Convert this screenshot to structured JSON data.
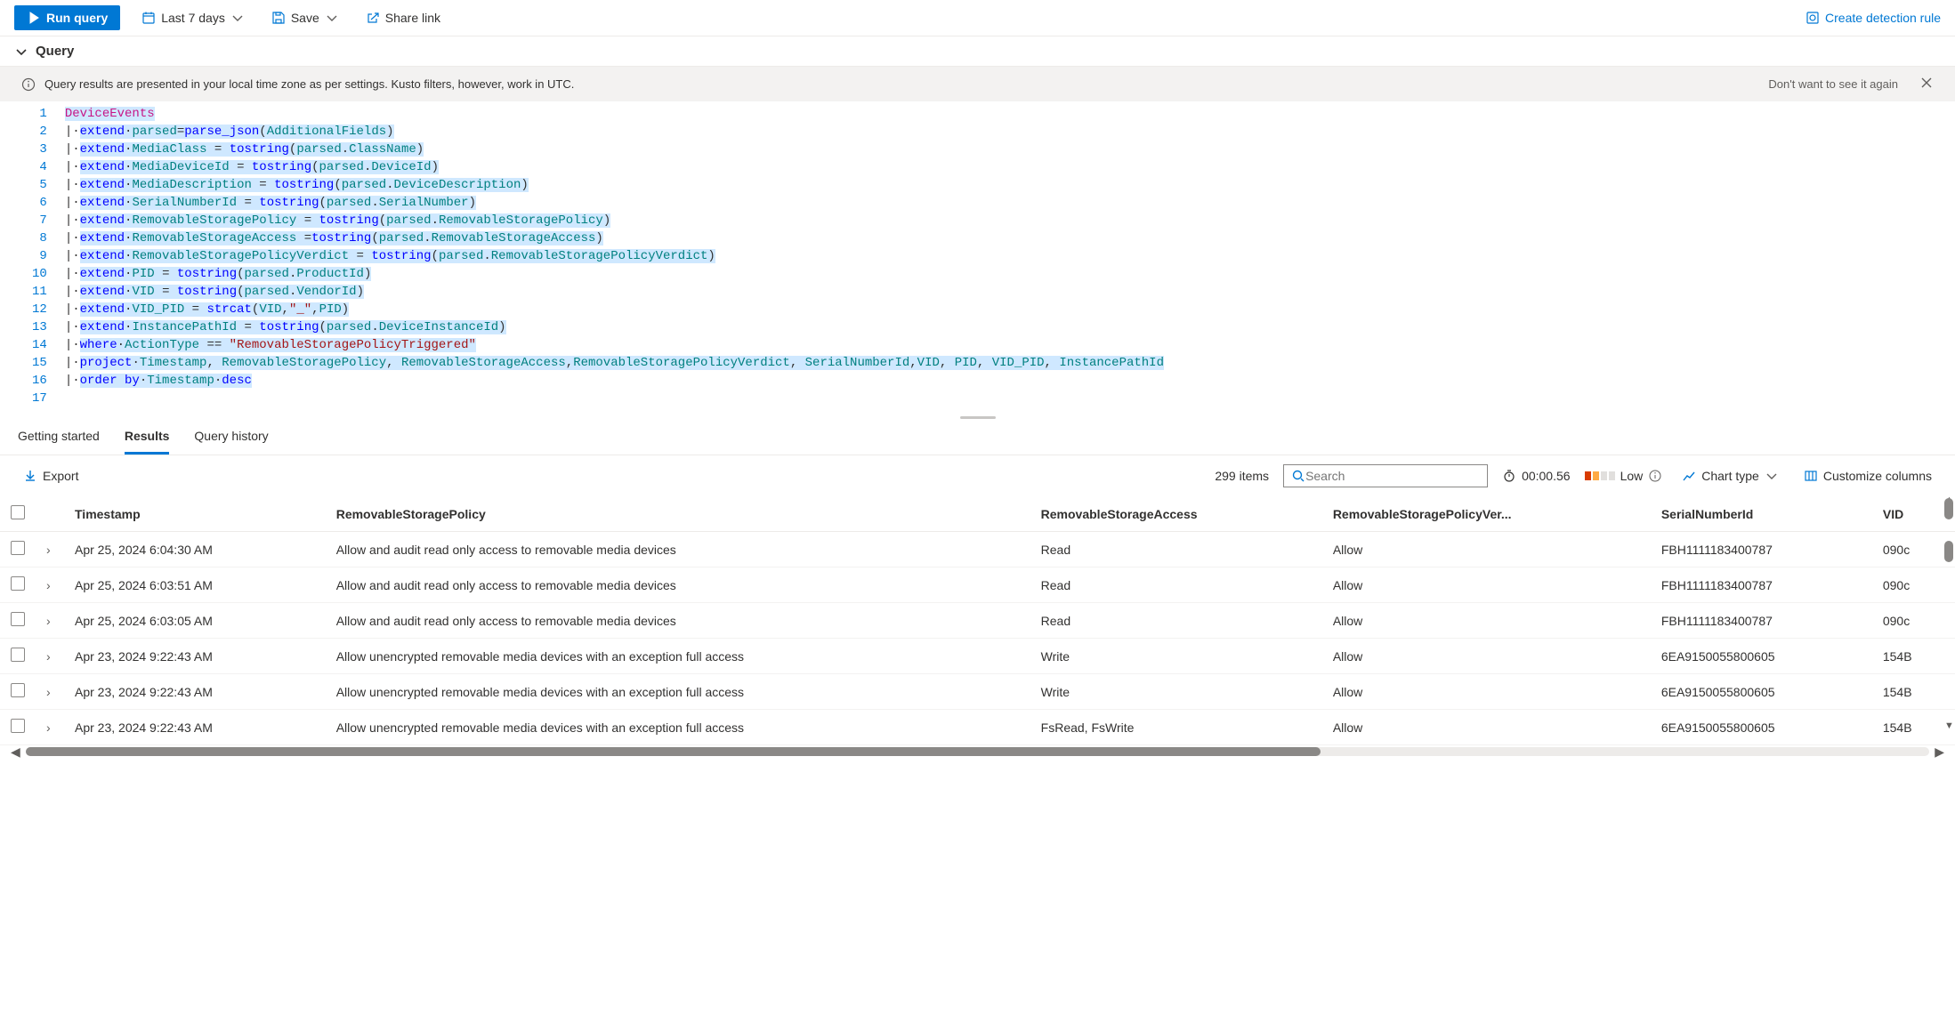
{
  "toolbar": {
    "run_label": "Run query",
    "time_label": "Last 7 days",
    "save_label": "Save",
    "share_label": "Share link",
    "create_rule_label": "Create detection rule"
  },
  "section": {
    "title": "Query"
  },
  "banner": {
    "text": "Query results are presented in your local time zone as per settings. Kusto filters, however, work in UTC.",
    "dismiss": "Don't want to see it again"
  },
  "editor": {
    "lines": [
      {
        "n": "1"
      },
      {
        "n": "2"
      },
      {
        "n": "3"
      },
      {
        "n": "4"
      },
      {
        "n": "5"
      },
      {
        "n": "6"
      },
      {
        "n": "7"
      },
      {
        "n": "8"
      },
      {
        "n": "9"
      },
      {
        "n": "10"
      },
      {
        "n": "11"
      },
      {
        "n": "12"
      },
      {
        "n": "13"
      },
      {
        "n": "14"
      },
      {
        "n": "15"
      },
      {
        "n": "16"
      },
      {
        "n": "17"
      }
    ],
    "tokens": {
      "device_events": "DeviceEvents",
      "extend": "extend",
      "where": "where",
      "project": "project",
      "order_by": "order by",
      "desc": "desc",
      "parsed": "parsed",
      "parse_json": "parse_json",
      "additional_fields": "AdditionalFields",
      "tostring": "tostring",
      "strcat": "strcat",
      "media_class": "MediaClass",
      "class_name": "ClassName",
      "media_device_id": "MediaDeviceId",
      "device_id": "DeviceId",
      "media_description": "MediaDescription",
      "device_description": "DeviceDescription",
      "serial_number_id": "SerialNumberId",
      "serial_number": "SerialNumber",
      "removable_storage_policy": "RemovableStoragePolicy",
      "removable_storage_access": "RemovableStorageAccess",
      "removable_storage_policy_verdict": "RemovableStoragePolicyVerdict",
      "pid": "PID",
      "product_id": "ProductId",
      "vid": "VID",
      "vendor_id": "VendorId",
      "vid_pid": "VID_PID",
      "underscore": "\"_\"",
      "instance_path_id": "InstancePathId",
      "device_instance_id": "DeviceInstanceId",
      "action_type": "ActionType",
      "triggered_str": "\"RemovableStoragePolicyTriggered\"",
      "timestamp": "Timestamp"
    }
  },
  "tabs": {
    "getting_started": "Getting started",
    "results": "Results",
    "history": "Query history"
  },
  "result_toolbar": {
    "export": "Export",
    "items": "299 items",
    "search_placeholder": "Search",
    "elapsed": "00:00.56",
    "perf": "Low",
    "chart_type": "Chart type",
    "customize": "Customize columns"
  },
  "table": {
    "columns": [
      "Timestamp",
      "RemovableStoragePolicy",
      "RemovableStorageAccess",
      "RemovableStoragePolicyVer...",
      "SerialNumberId",
      "VID"
    ],
    "rows": [
      {
        "ts": "Apr 25, 2024 6:04:30 AM",
        "policy": "Allow and audit read only access to removable media devices",
        "access": "Read",
        "verdict": "Allow",
        "serial": "FBH1111183400787",
        "vid": "090c"
      },
      {
        "ts": "Apr 25, 2024 6:03:51 AM",
        "policy": "Allow and audit read only access to removable media devices",
        "access": "Read",
        "verdict": "Allow",
        "serial": "FBH1111183400787",
        "vid": "090c"
      },
      {
        "ts": "Apr 25, 2024 6:03:05 AM",
        "policy": "Allow and audit read only access to removable media devices",
        "access": "Read",
        "verdict": "Allow",
        "serial": "FBH1111183400787",
        "vid": "090c"
      },
      {
        "ts": "Apr 23, 2024 9:22:43 AM",
        "policy": "Allow unencrypted removable media devices with an exception full access",
        "access": "Write",
        "verdict": "Allow",
        "serial": "6EA9150055800605",
        "vid": "154B"
      },
      {
        "ts": "Apr 23, 2024 9:22:43 AM",
        "policy": "Allow unencrypted removable media devices with an exception full access",
        "access": "Write",
        "verdict": "Allow",
        "serial": "6EA9150055800605",
        "vid": "154B"
      },
      {
        "ts": "Apr 23, 2024 9:22:43 AM",
        "policy": "Allow unencrypted removable media devices with an exception full access",
        "access": "FsRead, FsWrite",
        "verdict": "Allow",
        "serial": "6EA9150055800605",
        "vid": "154B"
      }
    ]
  }
}
